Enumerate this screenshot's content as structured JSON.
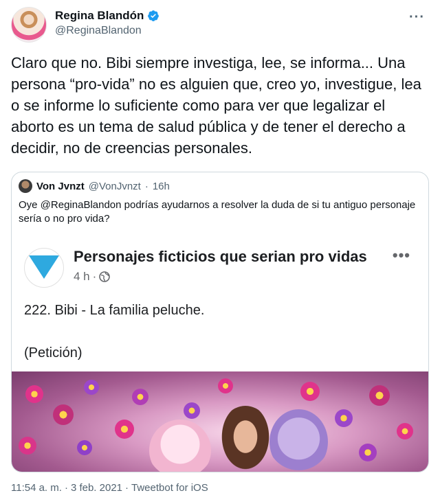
{
  "author": {
    "display_name": "Regina Blandón",
    "handle": "@ReginaBlandon",
    "verified": true,
    "more_icon": "more-horizontal-icon"
  },
  "tweet": {
    "text": "Claro que no. Bibi siempre investiga, lee, se informa... Una persona “pro-vida” no es alguien que, creo yo, investigue, lea o se informe lo suficiente como para ver que legalizar el aborto es un tema de salud pública y de tener el derecho a decidir, no de creencias personales."
  },
  "quote": {
    "display_name": "Von Jvnzt",
    "handle": "@VonJvnzt",
    "dot": "·",
    "time": "16h",
    "text": "Oye @ReginaBlandon podrías ayudarnos a resolver la duda de si tu antiguo personaje sería o no pro vida?"
  },
  "fb_post": {
    "page_name": "Personajes ficticios que serian pro vidas",
    "time": "4 h",
    "dot": "·",
    "globe_icon": "globe-icon",
    "more_icon": "more-horizontal-icon",
    "line1": "222. Bibi - La familia peluche.",
    "line2": "(Petición)"
  },
  "meta": {
    "time": "11:54 a. m.",
    "dot": "·",
    "date": "3 feb. 2021",
    "source": "Tweetbot for iOS"
  },
  "colors": {
    "verified_blue": "#1d9bf0",
    "secondary_text": "#536471",
    "border": "#cfd9de"
  }
}
